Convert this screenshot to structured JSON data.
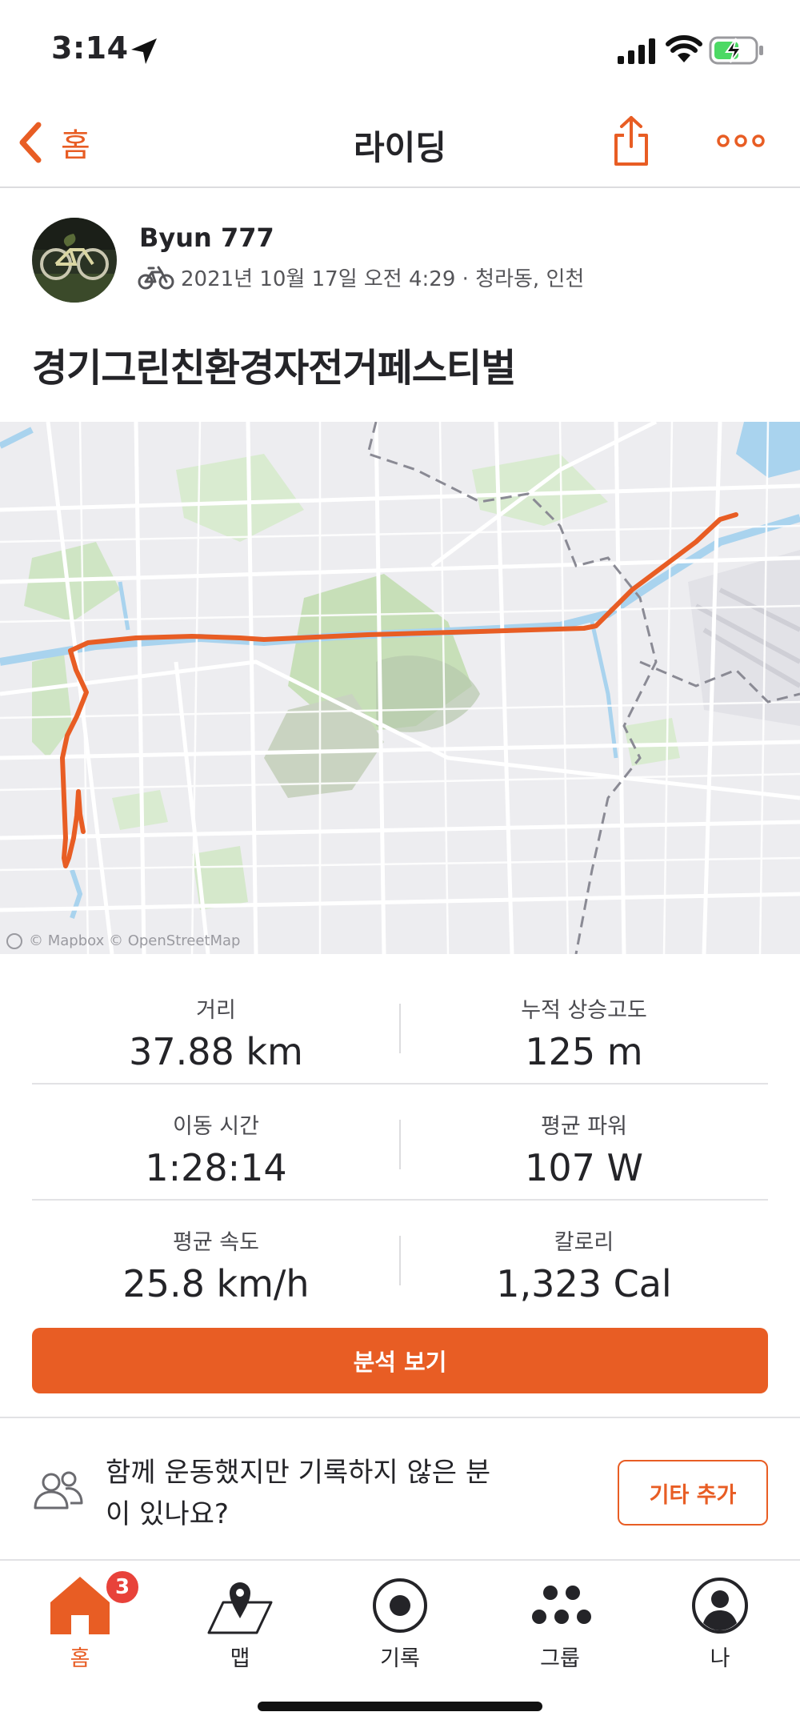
{
  "status_bar": {
    "time": "3:14"
  },
  "header": {
    "back_label": "홈",
    "title": "라이딩"
  },
  "athlete": {
    "name": "Byun 777",
    "meta": "2021년 10월 17일 오전 4:29 · 청라동, 인천"
  },
  "activity": {
    "title": "경기그린친환경자전거페스티벌"
  },
  "map": {
    "attribution": "© Mapbox © OpenStreetMap",
    "route_color": "#e85d24"
  },
  "stats": [
    {
      "left": {
        "label": "거리",
        "value": "37.88 km"
      },
      "right": {
        "label": "누적 상승고도",
        "value": "125 m"
      }
    },
    {
      "left": {
        "label": "이동 시간",
        "value": "1:28:14"
      },
      "right": {
        "label": "평균 파워",
        "value": "107 W"
      }
    },
    {
      "left": {
        "label": "평균 속도",
        "value": "25.8 km/h"
      },
      "right": {
        "label": "칼로리",
        "value": "1,323 Cal"
      }
    }
  ],
  "analysis_button": "분석 보기",
  "add_others": {
    "text": "함께 운동했지만 기록하지 않은 분이 있나요?",
    "button": "기타 추가"
  },
  "tabs": [
    {
      "label": "홈",
      "icon": "home-icon",
      "active": true,
      "badge": "3"
    },
    {
      "label": "맵",
      "icon": "map-pin-icon",
      "active": false
    },
    {
      "label": "기록",
      "icon": "record-icon",
      "active": false
    },
    {
      "label": "그룹",
      "icon": "group-icon",
      "active": false
    },
    {
      "label": "나",
      "icon": "profile-icon",
      "active": false
    }
  ],
  "colors": {
    "accent": "#e85d24",
    "badge": "#e8423a",
    "text": "#242428"
  }
}
